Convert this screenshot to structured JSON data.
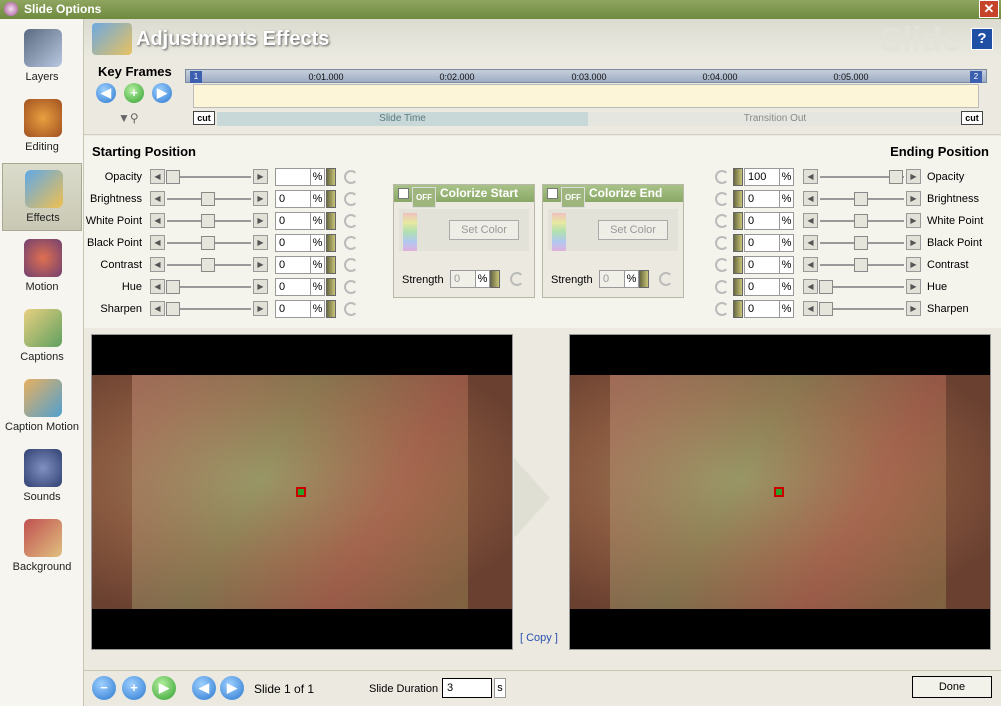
{
  "window": {
    "title": "Slide Options",
    "close_label": "✕"
  },
  "sidebar": {
    "items": [
      {
        "label": "Layers",
        "icon": "layers-icon",
        "selected": false
      },
      {
        "label": "Editing",
        "icon": "editing-icon",
        "selected": false
      },
      {
        "label": "Effects",
        "icon": "effects-icon",
        "selected": true
      },
      {
        "label": "Motion",
        "icon": "motion-icon",
        "selected": false
      },
      {
        "label": "Captions",
        "icon": "captions-icon",
        "selected": false
      },
      {
        "label": "Caption Motion",
        "icon": "caption-motion-icon",
        "selected": false
      },
      {
        "label": "Sounds",
        "icon": "sounds-icon",
        "selected": false
      },
      {
        "label": "Background",
        "icon": "background-icon",
        "selected": false
      }
    ]
  },
  "header": {
    "title": "Adjustments Effects",
    "watermark": "Slide",
    "help_label": "?"
  },
  "keyframes": {
    "title": "Key Frames",
    "ticks": [
      "0:01.000",
      "0:02.000",
      "0:03.000",
      "0:04.000",
      "0:05.000"
    ],
    "marker_start": "1",
    "marker_end": "2",
    "cut_left": "cut",
    "cut_right": "cut",
    "slide_time": "Slide Time",
    "transition_out": "Transition Out"
  },
  "starting": {
    "title": "Starting Position",
    "rows": [
      {
        "label": "Opacity",
        "value": "",
        "unit": "%",
        "level": 0.0
      },
      {
        "label": "Brightness",
        "value": "0",
        "unit": "%",
        "level": 0.5
      },
      {
        "label": "White Point",
        "value": "0",
        "unit": "%",
        "level": 0.5
      },
      {
        "label": "Black Point",
        "value": "0",
        "unit": "%",
        "level": 0.5
      },
      {
        "label": "Contrast",
        "value": "0",
        "unit": "%",
        "level": 0.5
      },
      {
        "label": "Hue",
        "value": "0",
        "unit": "%",
        "level": 0.0
      },
      {
        "label": "Sharpen",
        "value": "0",
        "unit": "%",
        "level": 0.0
      }
    ]
  },
  "ending": {
    "title": "Ending Position",
    "rows": [
      {
        "label": "Opacity",
        "value": "100",
        "unit": "%",
        "level": 1.0
      },
      {
        "label": "Brightness",
        "value": "0",
        "unit": "%",
        "level": 0.5
      },
      {
        "label": "White Point",
        "value": "0",
        "unit": "%",
        "level": 0.5
      },
      {
        "label": "Black Point",
        "value": "0",
        "unit": "%",
        "level": 0.5
      },
      {
        "label": "Contrast",
        "value": "0",
        "unit": "%",
        "level": 0.5
      },
      {
        "label": "Hue",
        "value": "0",
        "unit": "%",
        "level": 0.0
      },
      {
        "label": "Sharpen",
        "value": "0",
        "unit": "%",
        "level": 0.0
      }
    ]
  },
  "colorize_start": {
    "toggle": "OFF",
    "title": "Colorize Start",
    "set_color": "Set Color",
    "strength_label": "Strength",
    "strength_value": "0",
    "unit": "%"
  },
  "colorize_end": {
    "toggle": "OFF",
    "title": "Colorize End",
    "set_color": "Set Color",
    "strength_label": "Strength",
    "strength_value": "0",
    "unit": "%"
  },
  "preview": {
    "copy_label": "[ Copy ]"
  },
  "bottom": {
    "slide_count": "Slide 1 of 1",
    "duration_label": "Slide Duration",
    "duration_value": "3",
    "duration_unit": "s",
    "done_label": "Done"
  },
  "colors": {
    "title_bar": "#7e9a4e",
    "accent": "#2a78d0",
    "colorize_header": "#98b577"
  }
}
